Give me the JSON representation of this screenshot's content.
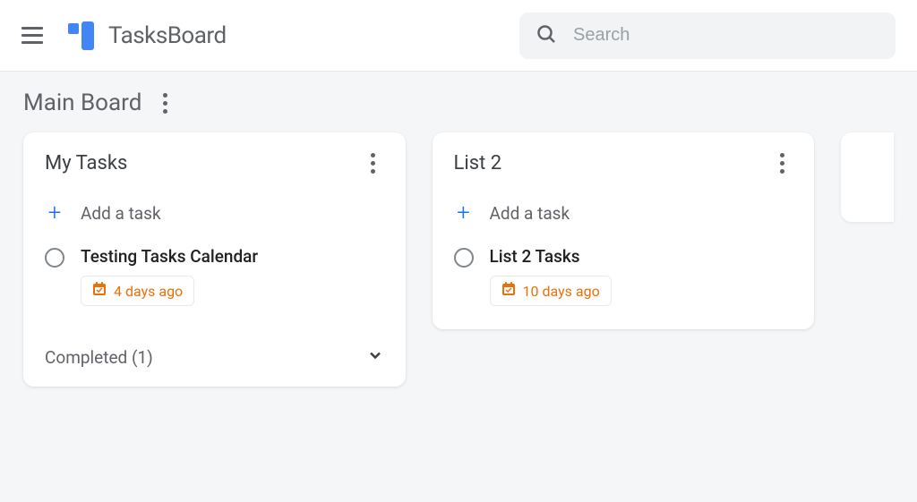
{
  "app": {
    "name": "TasksBoard"
  },
  "search": {
    "placeholder": "Search"
  },
  "board": {
    "title": "Main Board"
  },
  "lists": [
    {
      "title": "My Tasks",
      "addLabel": "Add a task",
      "tasks": [
        {
          "title": "Testing Tasks Calendar",
          "date": "4 days ago"
        }
      ],
      "completed": {
        "label": "Completed (1)"
      }
    },
    {
      "title": "List 2",
      "addLabel": "Add a task",
      "tasks": [
        {
          "title": "List 2 Tasks",
          "date": "10 days ago"
        }
      ]
    }
  ]
}
